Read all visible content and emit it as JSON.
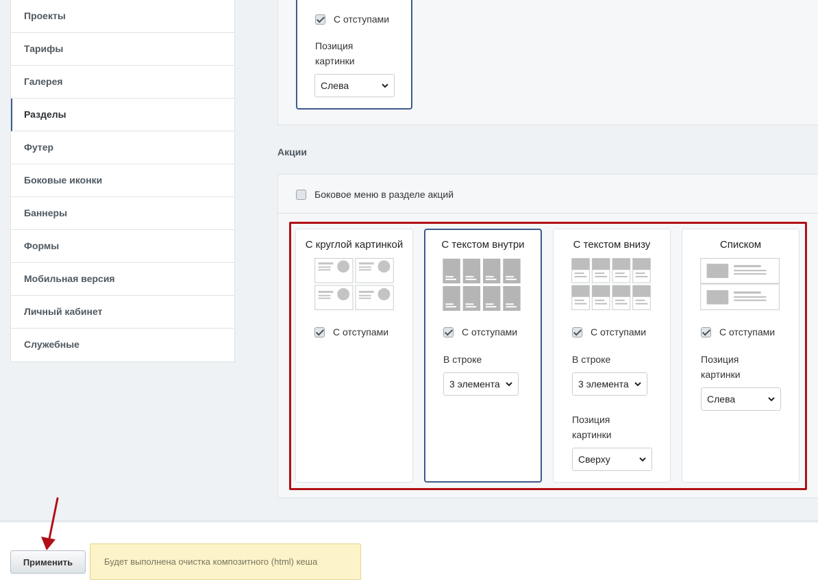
{
  "sidebar": {
    "items": [
      {
        "label": "Проекты"
      },
      {
        "label": "Тарифы"
      },
      {
        "label": "Галерея"
      },
      {
        "label": "Разделы",
        "active": true
      },
      {
        "label": "Футер"
      },
      {
        "label": "Боковые иконки"
      },
      {
        "label": "Баннеры"
      },
      {
        "label": "Формы"
      },
      {
        "label": "Мобильная версия"
      },
      {
        "label": "Личный кабинет"
      },
      {
        "label": "Служебные"
      }
    ]
  },
  "top_card": {
    "padding_label": "С отступами",
    "padding_checked": true,
    "image_position_label": "Позиция картинки",
    "image_position_value": "Слева"
  },
  "promotions": {
    "section_title": "Акции",
    "side_menu_label": "Боковое меню в разделе акций",
    "side_menu_checked": false,
    "cards": [
      {
        "title": "С круглой картинкой",
        "padding_label": "С отступами",
        "padding_checked": true,
        "selected": false,
        "icon": "round-image-layout-icon"
      },
      {
        "title": "С текстом внутри",
        "padding_label": "С отступами",
        "padding_checked": true,
        "selected": true,
        "row_label": "В строке",
        "row_value": "3 элемента",
        "icon": "text-inside-layout-icon"
      },
      {
        "title": "С текстом внизу",
        "padding_label": "С отступами",
        "padding_checked": true,
        "selected": false,
        "row_label": "В строке",
        "row_value": "3 элемента",
        "image_position_label": "Позиция картинки",
        "image_position_value": "Сверху",
        "icon": "text-below-layout-icon"
      },
      {
        "title": "Списком",
        "padding_label": "С отступами",
        "padding_checked": true,
        "selected": false,
        "image_position_label": "Позиция картинки",
        "image_position_value": "Слева",
        "icon": "list-layout-icon"
      }
    ]
  },
  "footer": {
    "apply_label": "Применить",
    "notice": "Будет выполнена очистка композитного (html) кеша"
  },
  "colors": {
    "accent": "#3c5a8c",
    "highlight": "#b10f14",
    "notice_bg": "#fcf3c8",
    "annotation_arrow": "#b10f14"
  }
}
